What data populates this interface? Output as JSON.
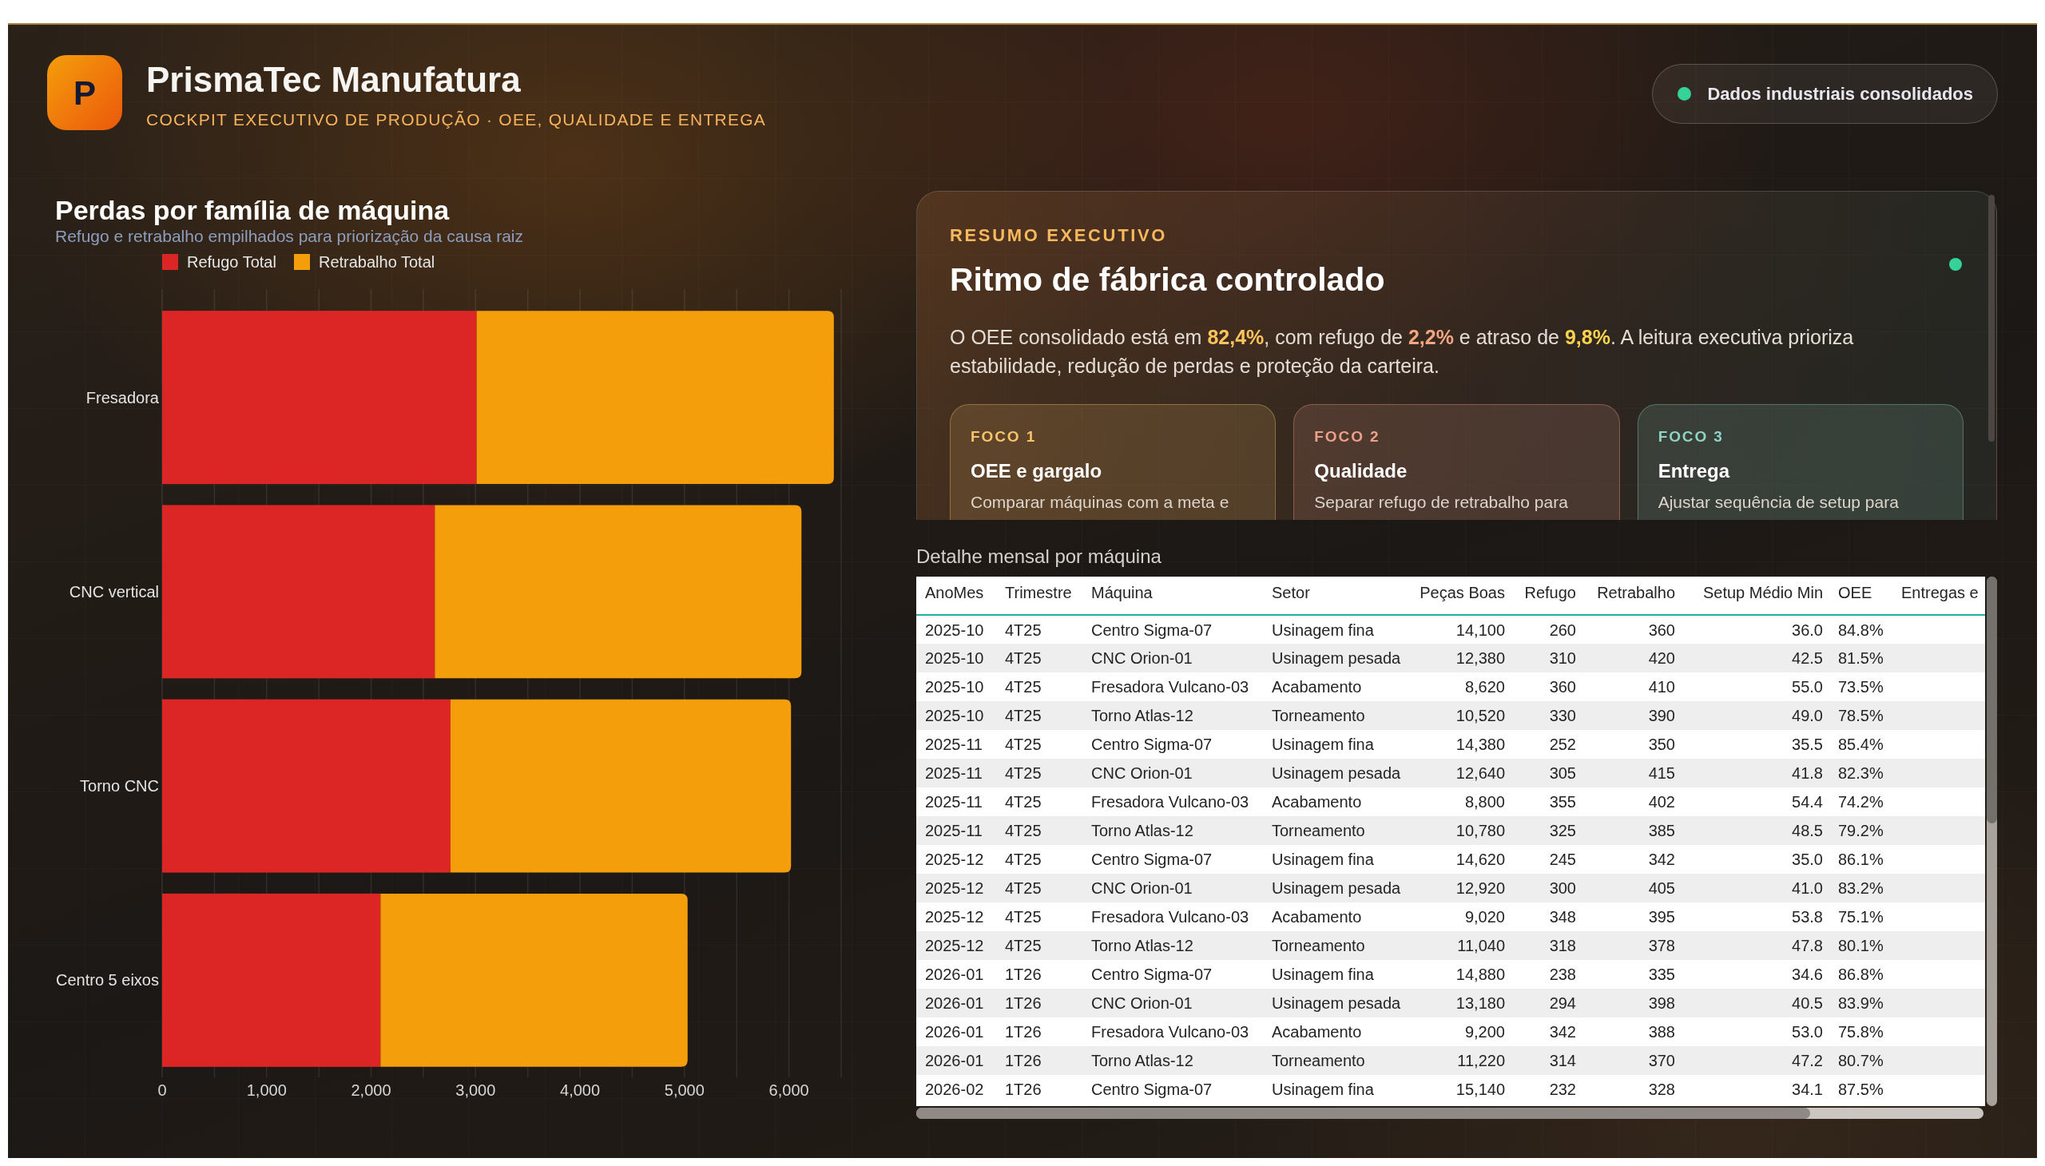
{
  "header": {
    "logo": "P",
    "title": "PrismaTec Manufatura",
    "subtitle": "COCKPIT EXECUTIVO DE PRODUÇÃO · OEE, QUALIDADE E ENTREGA",
    "status": "Dados industriais consolidados"
  },
  "loss_chart": {
    "subtitle": "Refugo e retrabalho empilhados para priorização da causa raiz",
    "chart_data": {
      "type": "bar",
      "orientation": "horizontal",
      "stacked": true,
      "title": "Perdas por família de máquina",
      "categories": [
        "Fresadora",
        "CNC vertical",
        "Torno CNC",
        "Centro 5 eixos"
      ],
      "series": [
        {
          "name": "Refugo Total",
          "color": "#dc2626",
          "values": [
            3010,
            2610,
            2760,
            2090
          ]
        },
        {
          "name": "Retrabalho Total",
          "color": "#f59e0b",
          "values": [
            3420,
            3510,
            3260,
            2940
          ]
        }
      ],
      "xlim": [
        0,
        6500
      ],
      "xticks": [
        {
          "value": 0,
          "label": "0"
        },
        {
          "value": 1000,
          "label": "1,000"
        },
        {
          "value": 2000,
          "label": "2,000"
        },
        {
          "value": 3000,
          "label": "3,000"
        },
        {
          "value": 4000,
          "label": "4,000"
        },
        {
          "value": 5000,
          "label": "5,000"
        },
        {
          "value": 6000,
          "label": "6,000"
        }
      ],
      "grid": true,
      "legend": true
    }
  },
  "summary": {
    "eyebrow": "RESUMO EXECUTIVO",
    "title": "Ritmo de fábrica controlado",
    "text": "O OEE consolidado está em **82,4%**, com refugo de **2,2%** e atraso de **9,8%**. A leitura executiva prioriza estabilidade, redução de perdas e proteção da carteira.",
    "focus": [
      {
        "label": "FOCO 1",
        "title": "OEE e gargalo",
        "text": "Comparar máquinas com a meta e",
        "color": "#f8c36a"
      },
      {
        "label": "FOCO 2",
        "title": "Qualidade",
        "text": "Separar refugo de retrabalho para",
        "color": "#ee9f8a"
      },
      {
        "label": "FOCO 3",
        "title": "Entrega",
        "text": "Ajustar sequência de setup para",
        "color": "#8fd3c3"
      }
    ]
  },
  "detail_table": {
    "title": "Detalhe mensal por máquina",
    "columns": [
      {
        "label": "AnoMes",
        "kind": "text"
      },
      {
        "label": "Trimestre",
        "kind": "text"
      },
      {
        "label": "Máquina",
        "kind": "text"
      },
      {
        "label": "Setor",
        "kind": "text"
      },
      {
        "label": "Peças Boas",
        "kind": "number"
      },
      {
        "label": "Refugo",
        "kind": "number"
      },
      {
        "label": "Retrabalho",
        "kind": "number"
      },
      {
        "label": "Setup Médio Min",
        "kind": "number"
      },
      {
        "label": "OEE",
        "kind": "percent"
      },
      {
        "label": "Entregas e",
        "kind": "text"
      }
    ],
    "rows": [
      [
        "2025-10",
        "4T25",
        "Centro Sigma-07",
        "Usinagem fina",
        "14,100",
        "260",
        "360",
        "36.0",
        "84.8%"
      ],
      [
        "2025-10",
        "4T25",
        "CNC Orion-01",
        "Usinagem pesada",
        "12,380",
        "310",
        "420",
        "42.5",
        "81.5%"
      ],
      [
        "2025-10",
        "4T25",
        "Fresadora Vulcano-03",
        "Acabamento",
        "8,620",
        "360",
        "410",
        "55.0",
        "73.5%"
      ],
      [
        "2025-10",
        "4T25",
        "Torno Atlas-12",
        "Torneamento",
        "10,520",
        "330",
        "390",
        "49.0",
        "78.5%"
      ],
      [
        "2025-11",
        "4T25",
        "Centro Sigma-07",
        "Usinagem fina",
        "14,380",
        "252",
        "350",
        "35.5",
        "85.4%"
      ],
      [
        "2025-11",
        "4T25",
        "CNC Orion-01",
        "Usinagem pesada",
        "12,640",
        "305",
        "415",
        "41.8",
        "82.3%"
      ],
      [
        "2025-11",
        "4T25",
        "Fresadora Vulcano-03",
        "Acabamento",
        "8,800",
        "355",
        "402",
        "54.4",
        "74.2%"
      ],
      [
        "2025-11",
        "4T25",
        "Torno Atlas-12",
        "Torneamento",
        "10,780",
        "325",
        "385",
        "48.5",
        "79.2%"
      ],
      [
        "2025-12",
        "4T25",
        "Centro Sigma-07",
        "Usinagem fina",
        "14,620",
        "245",
        "342",
        "35.0",
        "86.1%"
      ],
      [
        "2025-12",
        "4T25",
        "CNC Orion-01",
        "Usinagem pesada",
        "12,920",
        "300",
        "405",
        "41.0",
        "83.2%"
      ],
      [
        "2025-12",
        "4T25",
        "Fresadora Vulcano-03",
        "Acabamento",
        "9,020",
        "348",
        "395",
        "53.8",
        "75.1%"
      ],
      [
        "2025-12",
        "4T25",
        "Torno Atlas-12",
        "Torneamento",
        "11,040",
        "318",
        "378",
        "47.8",
        "80.1%"
      ],
      [
        "2026-01",
        "1T26",
        "Centro Sigma-07",
        "Usinagem fina",
        "14,880",
        "238",
        "335",
        "34.6",
        "86.8%"
      ],
      [
        "2026-01",
        "1T26",
        "CNC Orion-01",
        "Usinagem pesada",
        "13,180",
        "294",
        "398",
        "40.5",
        "83.9%"
      ],
      [
        "2026-01",
        "1T26",
        "Fresadora Vulcano-03",
        "Acabamento",
        "9,200",
        "342",
        "388",
        "53.0",
        "75.8%"
      ],
      [
        "2026-01",
        "1T26",
        "Torno Atlas-12",
        "Torneamento",
        "11,220",
        "314",
        "370",
        "47.2",
        "80.7%"
      ],
      [
        "2026-02",
        "1T26",
        "Centro Sigma-07",
        "Usinagem fina",
        "15,140",
        "232",
        "328",
        "34.1",
        "87.5%"
      ]
    ]
  }
}
